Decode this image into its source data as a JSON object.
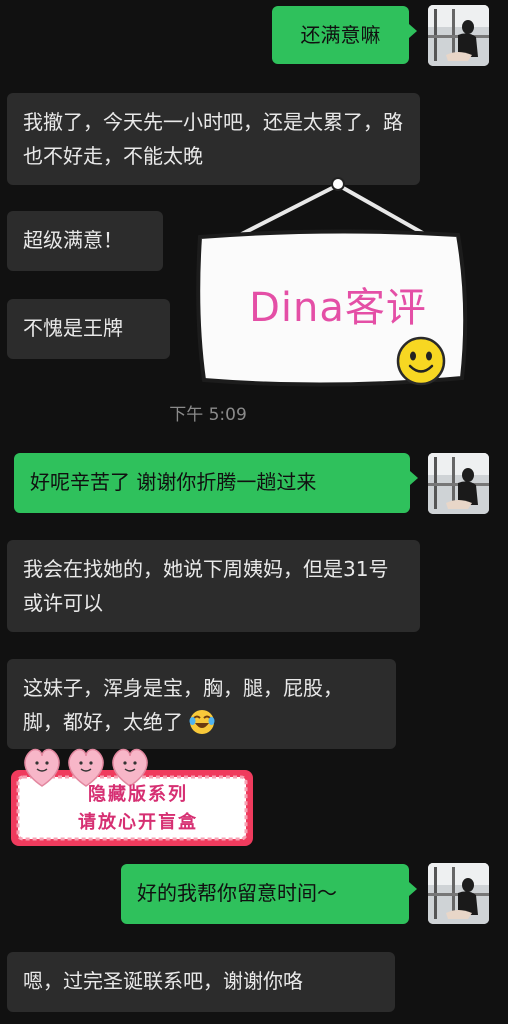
{
  "messages": {
    "m1": "还满意嘛",
    "m2": "我撤了，今天先一小时吧，还是太累了，路也不好走，不能太晚",
    "m3": "超级满意！",
    "m4": "不愧是王牌",
    "m5": "好呢辛苦了 谢谢你折腾一趟过来",
    "m6": "我会在找她的，她说下周姨妈，但是31号或许可以",
    "m7": "这妹子，浑身是宝，胸，腿，屁股，脚，都好，太绝了",
    "m8": "好的我帮你留意时间～",
    "m9": "嗯，过完圣诞联系吧，谢谢你咯"
  },
  "timestamp": "下午 5:09",
  "sticker_sign": {
    "text": "Dina客评"
  },
  "sticker_banner": {
    "line1": "隐藏版系列",
    "line2": "请放心开盲盒"
  },
  "colors": {
    "background": "#111111",
    "incoming_bubble": "#2c2c2c",
    "outgoing_bubble": "#2fc15c",
    "sign_text": "#e44fa6",
    "banner_text": "#d62f72"
  },
  "icons": {
    "avatar": "user-avatar-photo",
    "emoji": "tears-of-joy-emoji",
    "smiley": "smiley-face-icon",
    "hearts": "heart-faces-icon"
  }
}
